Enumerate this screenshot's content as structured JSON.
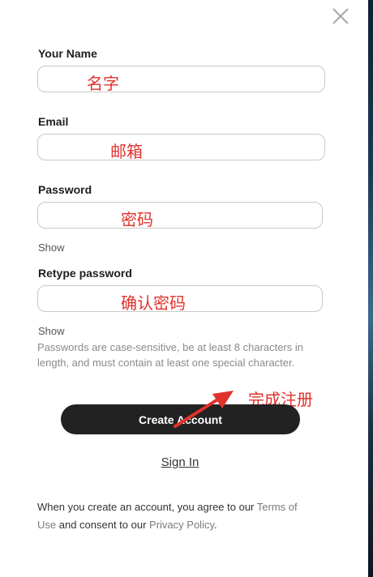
{
  "form": {
    "name_label": "Your Name",
    "name_annotation": "名字",
    "email_label": "Email",
    "email_annotation": "邮箱",
    "password_label": "Password",
    "password_annotation": "密码",
    "password_show": "Show",
    "retype_label": "Retype password",
    "retype_annotation": "确认密码",
    "retype_show": "Show",
    "password_hint": "Passwords are case-sensitive, be at least 8 characters in length, and must contain at least one special character."
  },
  "actions": {
    "create_label": "Create Account",
    "create_annotation": "完成注册",
    "signin_label": "Sign In"
  },
  "footer": {
    "text_before": "When you create an account, you agree to our ",
    "terms_link": "Terms of Use",
    "text_middle": " and consent to our ",
    "privacy_link": "Privacy Policy",
    "text_after": "."
  },
  "colors": {
    "annotation": "#e0322c",
    "button": "#222222"
  },
  "icons": {
    "close": "close-icon",
    "annotation_arrow": "arrow-icon"
  }
}
